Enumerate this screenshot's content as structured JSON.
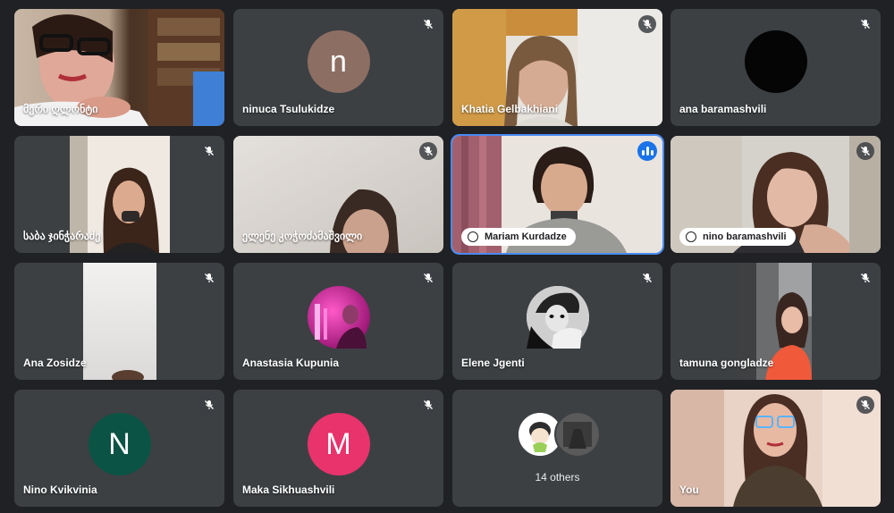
{
  "participants": [
    {
      "name": "მერი ღლონტი",
      "kind": "video"
    },
    {
      "name": "ninuca Tsulukidze",
      "kind": "avatar",
      "initial": "n",
      "color": "#8d6e63"
    },
    {
      "name": "Khatia Gelbakhiani",
      "kind": "video"
    },
    {
      "name": "ana baramashvili",
      "kind": "avatar-photo"
    },
    {
      "name": "საბა ჯინჭარაძე",
      "kind": "video"
    },
    {
      "name": "ელენე კოჭოძამაშვილი",
      "kind": "video"
    },
    {
      "name": "Mariam Kurdadze",
      "kind": "video",
      "speaking": true
    },
    {
      "name": "nino baramashvili",
      "kind": "video"
    },
    {
      "name": "Ana Zosidze",
      "kind": "video"
    },
    {
      "name": "Anastasia Kupunia",
      "kind": "avatar-photo"
    },
    {
      "name": "Elene Jgenti",
      "kind": "avatar-photo"
    },
    {
      "name": "tamuna gongladze",
      "kind": "video"
    },
    {
      "name": "Nino Kvikvinia",
      "kind": "avatar",
      "initial": "N",
      "color": "#0b5345"
    },
    {
      "name": "Maka Sikhuashvili",
      "kind": "avatar",
      "initial": "M",
      "color": "#e8336d"
    },
    {
      "name": "14 others",
      "kind": "others"
    },
    {
      "name": "You",
      "kind": "video",
      "self": true
    }
  ],
  "colors": {
    "background": "#202124",
    "tile": "#3c4043",
    "active_outline": "#4a8af4"
  },
  "icons": {
    "muted": "mic-off-icon",
    "speaking": "audio-level-icon",
    "pinned": "hand-icon"
  }
}
